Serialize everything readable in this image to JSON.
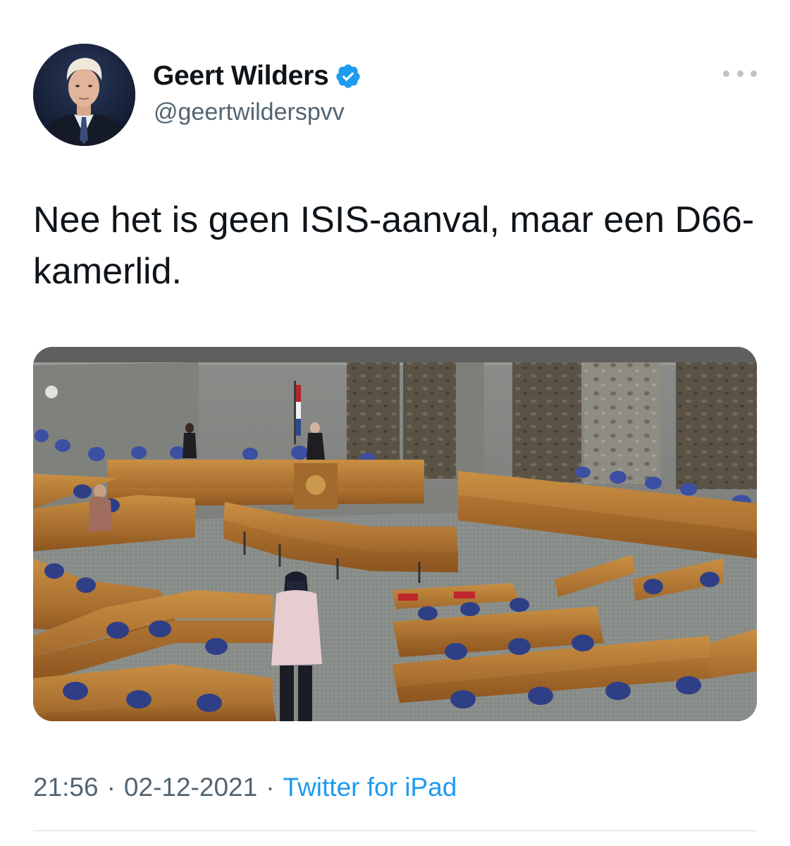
{
  "author": {
    "name": "Geert Wilders",
    "handle": "@geertwilderspvv",
    "verified": true,
    "avatar_icon": "profile-photo"
  },
  "menu_icon": "more-options-icon",
  "tweet": {
    "text": "Nee het is geen ISIS-aanval, maar een D66-kamerlid."
  },
  "media": {
    "type": "photo",
    "icon": "parliament-chamber-photo"
  },
  "meta": {
    "time": "21:56",
    "separator": "·",
    "date": "02-12-2021",
    "source": "Twitter for iPad"
  },
  "colors": {
    "link": "#1d9bf0",
    "verified": "#1d9bf0",
    "secondary_text": "#536471"
  }
}
